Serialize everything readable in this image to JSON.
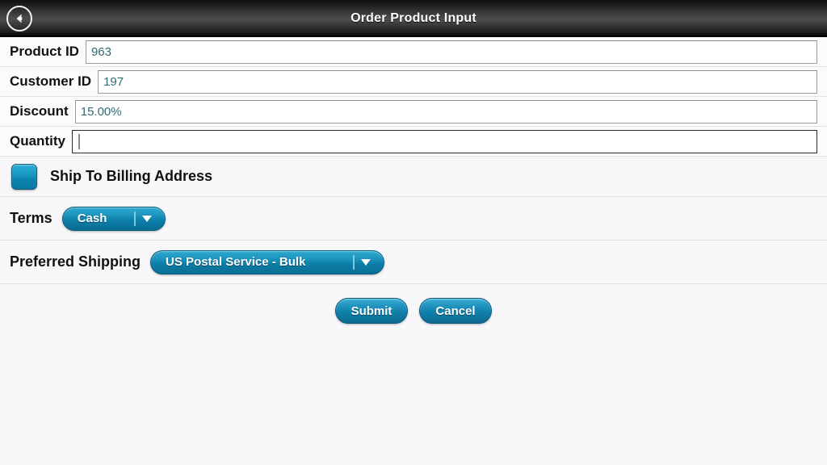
{
  "titlebar": {
    "title": "Order Product Input",
    "back_icon": "back-arrow-circle-icon"
  },
  "form": {
    "fields": [
      {
        "label": "Product ID",
        "value": "963",
        "placeholder": "",
        "focused": false
      },
      {
        "label": "Customer ID",
        "value": "197",
        "placeholder": "",
        "focused": false
      },
      {
        "label": "Discount",
        "value": "15.00%",
        "placeholder": "",
        "focused": false
      },
      {
        "label": "Quantity",
        "value": "",
        "placeholder": "",
        "focused": true
      }
    ],
    "checkbox": {
      "label": "Ship To Billing Address",
      "checked": true
    },
    "selects": [
      {
        "label": "Terms",
        "value": "Cash",
        "arrow_icon": "chevron-down-icon"
      },
      {
        "label": "Preferred Shipping",
        "value": "US Postal Service - Bulk",
        "arrow_icon": "chevron-down-icon"
      }
    ]
  },
  "actions": {
    "submit_label": "Submit",
    "cancel_label": "Cancel"
  },
  "colors": {
    "accent_blue": "#0d7ea8",
    "accent_blue_light": "#2fa9cf",
    "value_text": "#2f6b72",
    "titlebar_dark": "#101010",
    "page_bg": "#f7f7f9"
  }
}
